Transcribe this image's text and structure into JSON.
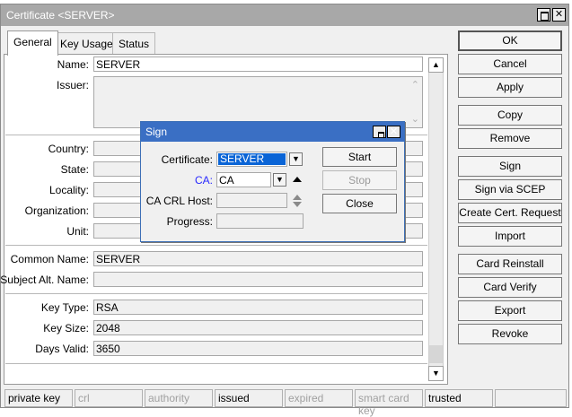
{
  "window": {
    "title": "Certificate <SERVER>",
    "restore_icon": "restore-icon",
    "close_icon": "close-icon",
    "close_glyph": "✕"
  },
  "tabs": [
    {
      "label": "General",
      "active": true
    },
    {
      "label": "Key Usage",
      "active": false
    },
    {
      "label": "Status",
      "active": false
    }
  ],
  "form": {
    "name_label": "Name:",
    "name_value": "SERVER",
    "issuer_label": "Issuer:",
    "country_label": "Country:",
    "state_label": "State:",
    "locality_label": "Locality:",
    "organization_label": "Organization:",
    "unit_label": "Unit:",
    "common_name_label": "Common Name:",
    "common_name_value": "SERVER",
    "subject_alt_label": "Subject Alt. Name:",
    "key_type_label": "Key Type:",
    "key_type_value": "RSA",
    "key_size_label": "Key Size:",
    "key_size_value": "2048",
    "days_valid_label": "Days Valid:",
    "days_valid_value": "3650"
  },
  "scroll": {
    "up_glyph": "▲",
    "down_glyph": "▼"
  },
  "buttons": [
    "OK",
    "Cancel",
    "Apply",
    "Copy",
    "Remove",
    "Sign",
    "Sign via SCEP",
    "Create Cert. Request",
    "Import",
    "Card Reinstall",
    "Card Verify",
    "Export",
    "Revoke"
  ],
  "status_bar": [
    {
      "text": "private key",
      "enabled": true
    },
    {
      "text": "crl",
      "enabled": false
    },
    {
      "text": "authority",
      "enabled": false
    },
    {
      "text": "issued",
      "enabled": true
    },
    {
      "text": "expired",
      "enabled": false
    },
    {
      "text": "smart card key",
      "enabled": false
    },
    {
      "text": "trusted",
      "enabled": true
    },
    {
      "text": "",
      "enabled": true
    }
  ],
  "sign_dialog": {
    "title": "Sign",
    "close_glyph": "✕",
    "certificate_label": "Certificate:",
    "certificate_value": "SERVER",
    "ca_label": "CA:",
    "ca_value": "CA",
    "ca_crl_host_label": "CA CRL Host:",
    "progress_label": "Progress:",
    "start_label": "Start",
    "stop_label": "Stop",
    "close_label": "Close",
    "dropdown_glyph": "▼",
    "ca_label_color": "#2a2aff",
    "selection_color": "#0a64d6"
  }
}
